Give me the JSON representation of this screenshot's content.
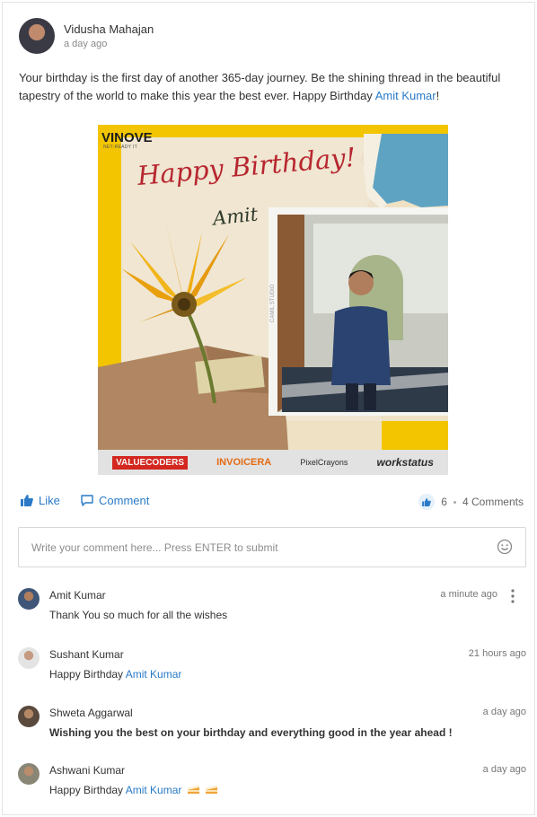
{
  "post": {
    "author": "Vidusha Mahajan",
    "time": "a day ago",
    "text_before": "Your birthday is the first day of another 365-day journey. Be the shining thread in the beautiful tapestry of the world to make this year the best ever. Happy Birthday ",
    "mention": "Amit Kumar",
    "text_after": "!"
  },
  "image": {
    "brand": "VINOVE",
    "brand_sub": "NET-READY IT",
    "heading": "Happy Birthday!",
    "name": "Amit",
    "sponsors": [
      "VALUECODERS",
      "INVOICERA",
      "PixelCrayons",
      "workstatus"
    ]
  },
  "actions": {
    "like_label": "Like",
    "comment_label": "Comment",
    "like_count": "6",
    "comments_count": "4 Comments"
  },
  "comment_box": {
    "placeholder": "Write your comment here... Press ENTER to submit"
  },
  "comments": [
    {
      "author": "Amit Kumar",
      "text": "Thank You so much for all the wishes",
      "time": "a minute ago"
    },
    {
      "author": "Sushant Kumar",
      "text": "Happy Birthday ",
      "mention": "Amit Kumar",
      "time": "21 hours ago"
    },
    {
      "author": "Shweta Aggarwal",
      "text": "Wishing you the best on your birthday and everything good in the year ahead !",
      "time": "a day ago"
    },
    {
      "author": "Ashwani Kumar",
      "text": "Happy Birthday ",
      "mention": "Amit Kumar",
      "time": "a day ago"
    }
  ],
  "colors": {
    "link": "#2a7ac7",
    "yellow": "#f2c500"
  }
}
